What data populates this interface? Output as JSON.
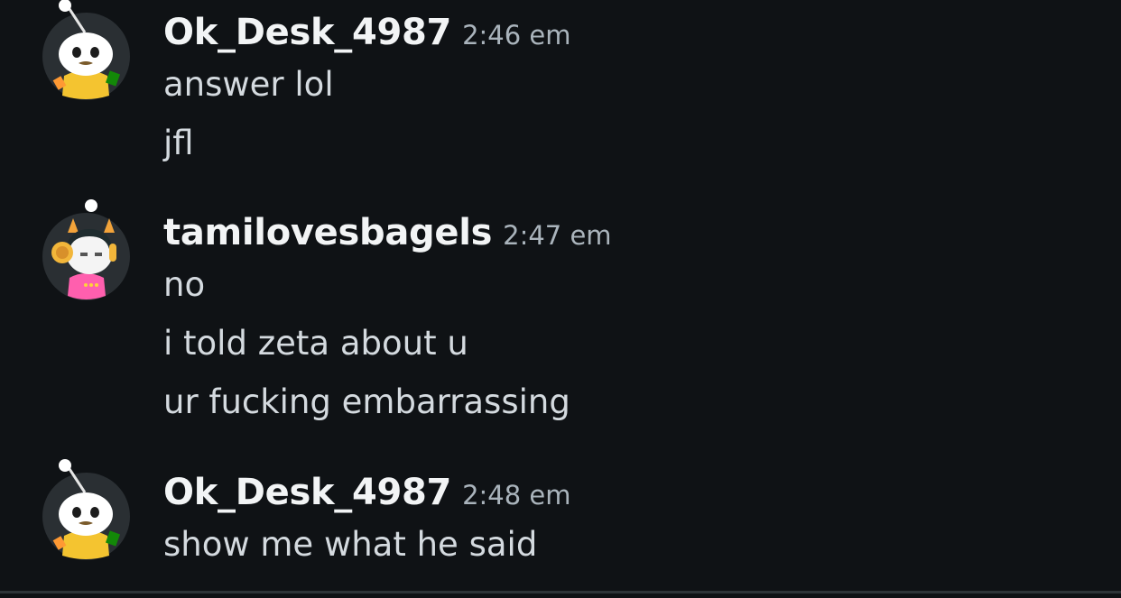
{
  "messages": [
    {
      "user": "Ok_Desk_4987",
      "avatar": "snoo-avatar-yellow",
      "time": "2:46 em",
      "lines": [
        "answer lol",
        "jfl"
      ]
    },
    {
      "user": "tamilovesbagels",
      "avatar": "snoo-avatar-headphones",
      "time": "2:47 em",
      "lines": [
        "no",
        "i told zeta about u",
        "ur fucking embarrassing"
      ]
    },
    {
      "user": "Ok_Desk_4987",
      "avatar": "snoo-avatar-yellow",
      "time": "2:48 em",
      "lines": [
        "show me what he said"
      ]
    }
  ],
  "colors": {
    "background": "#0f1215",
    "username": "#f2f4f5",
    "timestamp": "#aab4bc",
    "message_text": "#d4dadf"
  }
}
